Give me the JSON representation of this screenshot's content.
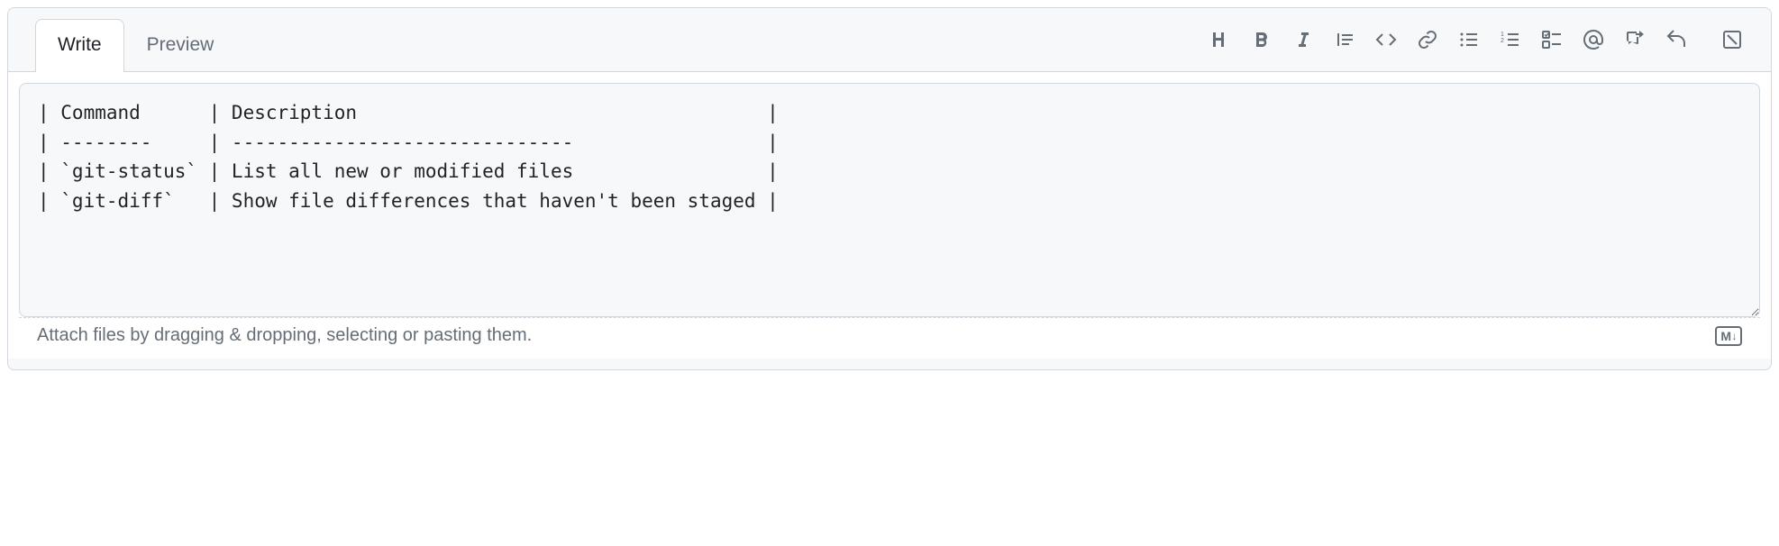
{
  "tabs": {
    "write": "Write",
    "preview": "Preview"
  },
  "editor": {
    "content": "| Command      | Description                                    |\n| --------     | ------------------------------                 |\n| `git-status` | List all new or modified files                 |\n| `git-diff`   | Show file differences that haven't been staged |"
  },
  "footer": {
    "attach_hint": "Attach files by dragging & dropping, selecting or pasting them.",
    "md_label": "M↓"
  }
}
